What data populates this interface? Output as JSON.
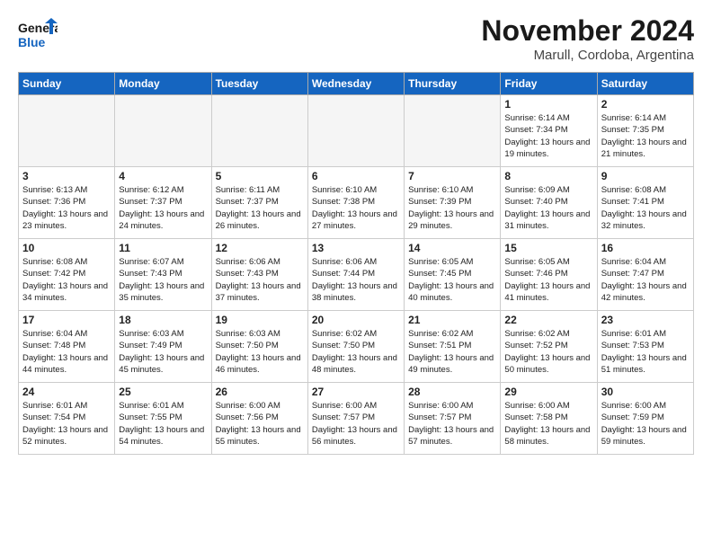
{
  "logo": {
    "line1": "General",
    "line2": "Blue"
  },
  "header": {
    "month": "November 2024",
    "location": "Marull, Cordoba, Argentina"
  },
  "weekdays": [
    "Sunday",
    "Monday",
    "Tuesday",
    "Wednesday",
    "Thursday",
    "Friday",
    "Saturday"
  ],
  "weeks": [
    [
      {
        "day": "",
        "info": ""
      },
      {
        "day": "",
        "info": ""
      },
      {
        "day": "",
        "info": ""
      },
      {
        "day": "",
        "info": ""
      },
      {
        "day": "",
        "info": ""
      },
      {
        "day": "1",
        "info": "Sunrise: 6:14 AM\nSunset: 7:34 PM\nDaylight: 13 hours\nand 19 minutes."
      },
      {
        "day": "2",
        "info": "Sunrise: 6:14 AM\nSunset: 7:35 PM\nDaylight: 13 hours\nand 21 minutes."
      }
    ],
    [
      {
        "day": "3",
        "info": "Sunrise: 6:13 AM\nSunset: 7:36 PM\nDaylight: 13 hours\nand 23 minutes."
      },
      {
        "day": "4",
        "info": "Sunrise: 6:12 AM\nSunset: 7:37 PM\nDaylight: 13 hours\nand 24 minutes."
      },
      {
        "day": "5",
        "info": "Sunrise: 6:11 AM\nSunset: 7:37 PM\nDaylight: 13 hours\nand 26 minutes."
      },
      {
        "day": "6",
        "info": "Sunrise: 6:10 AM\nSunset: 7:38 PM\nDaylight: 13 hours\nand 27 minutes."
      },
      {
        "day": "7",
        "info": "Sunrise: 6:10 AM\nSunset: 7:39 PM\nDaylight: 13 hours\nand 29 minutes."
      },
      {
        "day": "8",
        "info": "Sunrise: 6:09 AM\nSunset: 7:40 PM\nDaylight: 13 hours\nand 31 minutes."
      },
      {
        "day": "9",
        "info": "Sunrise: 6:08 AM\nSunset: 7:41 PM\nDaylight: 13 hours\nand 32 minutes."
      }
    ],
    [
      {
        "day": "10",
        "info": "Sunrise: 6:08 AM\nSunset: 7:42 PM\nDaylight: 13 hours\nand 34 minutes."
      },
      {
        "day": "11",
        "info": "Sunrise: 6:07 AM\nSunset: 7:43 PM\nDaylight: 13 hours\nand 35 minutes."
      },
      {
        "day": "12",
        "info": "Sunrise: 6:06 AM\nSunset: 7:43 PM\nDaylight: 13 hours\nand 37 minutes."
      },
      {
        "day": "13",
        "info": "Sunrise: 6:06 AM\nSunset: 7:44 PM\nDaylight: 13 hours\nand 38 minutes."
      },
      {
        "day": "14",
        "info": "Sunrise: 6:05 AM\nSunset: 7:45 PM\nDaylight: 13 hours\nand 40 minutes."
      },
      {
        "day": "15",
        "info": "Sunrise: 6:05 AM\nSunset: 7:46 PM\nDaylight: 13 hours\nand 41 minutes."
      },
      {
        "day": "16",
        "info": "Sunrise: 6:04 AM\nSunset: 7:47 PM\nDaylight: 13 hours\nand 42 minutes."
      }
    ],
    [
      {
        "day": "17",
        "info": "Sunrise: 6:04 AM\nSunset: 7:48 PM\nDaylight: 13 hours\nand 44 minutes."
      },
      {
        "day": "18",
        "info": "Sunrise: 6:03 AM\nSunset: 7:49 PM\nDaylight: 13 hours\nand 45 minutes."
      },
      {
        "day": "19",
        "info": "Sunrise: 6:03 AM\nSunset: 7:50 PM\nDaylight: 13 hours\nand 46 minutes."
      },
      {
        "day": "20",
        "info": "Sunrise: 6:02 AM\nSunset: 7:50 PM\nDaylight: 13 hours\nand 48 minutes."
      },
      {
        "day": "21",
        "info": "Sunrise: 6:02 AM\nSunset: 7:51 PM\nDaylight: 13 hours\nand 49 minutes."
      },
      {
        "day": "22",
        "info": "Sunrise: 6:02 AM\nSunset: 7:52 PM\nDaylight: 13 hours\nand 50 minutes."
      },
      {
        "day": "23",
        "info": "Sunrise: 6:01 AM\nSunset: 7:53 PM\nDaylight: 13 hours\nand 51 minutes."
      }
    ],
    [
      {
        "day": "24",
        "info": "Sunrise: 6:01 AM\nSunset: 7:54 PM\nDaylight: 13 hours\nand 52 minutes."
      },
      {
        "day": "25",
        "info": "Sunrise: 6:01 AM\nSunset: 7:55 PM\nDaylight: 13 hours\nand 54 minutes."
      },
      {
        "day": "26",
        "info": "Sunrise: 6:00 AM\nSunset: 7:56 PM\nDaylight: 13 hours\nand 55 minutes."
      },
      {
        "day": "27",
        "info": "Sunrise: 6:00 AM\nSunset: 7:57 PM\nDaylight: 13 hours\nand 56 minutes."
      },
      {
        "day": "28",
        "info": "Sunrise: 6:00 AM\nSunset: 7:57 PM\nDaylight: 13 hours\nand 57 minutes."
      },
      {
        "day": "29",
        "info": "Sunrise: 6:00 AM\nSunset: 7:58 PM\nDaylight: 13 hours\nand 58 minutes."
      },
      {
        "day": "30",
        "info": "Sunrise: 6:00 AM\nSunset: 7:59 PM\nDaylight: 13 hours\nand 59 minutes."
      }
    ]
  ]
}
